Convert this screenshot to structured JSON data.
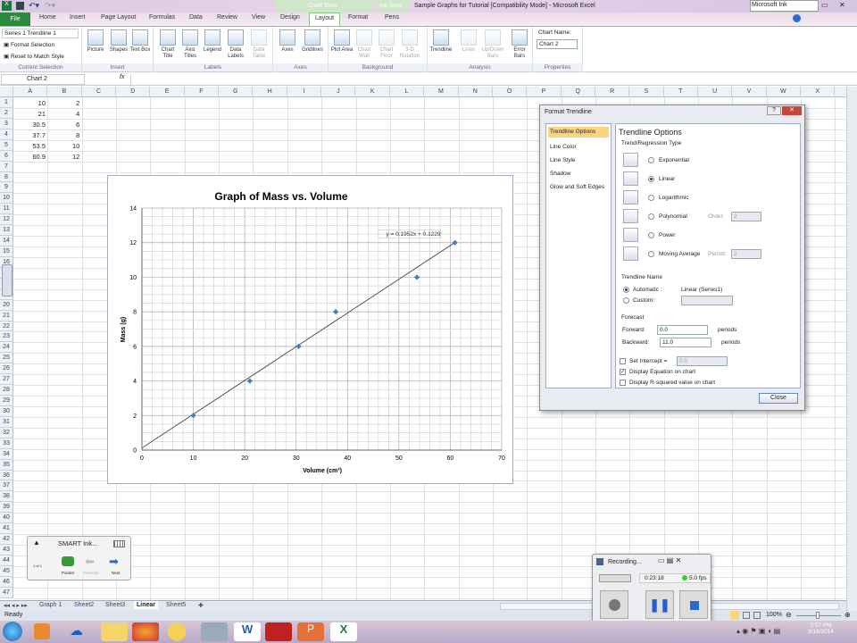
{
  "window": {
    "title": "Sample Graphs for Tutorial  [Compatibility Mode]  -  Microsoft Excel",
    "chart_tools": "Chart Tools",
    "ink_tools": "Ink Tools",
    "ink_toolbar": "Microsoft Ink"
  },
  "tabs": [
    "File",
    "Home",
    "Insert",
    "Page Layout",
    "Formulas",
    "Data",
    "Review",
    "View",
    "Design",
    "Layout",
    "Format",
    "Pens"
  ],
  "ribbon": {
    "selection_dropdown": "Series 1 Trendline 1",
    "format_selection": "Format Selection",
    "reset_style": "Reset to Match Style",
    "groups": [
      "Current Selection",
      "Insert",
      "Labels",
      "Axes",
      "Background",
      "Analysis",
      "Properties"
    ],
    "buttons": [
      "Picture",
      "Shapes",
      "Text Box",
      "Chart Title",
      "Axis Titles",
      "Legend",
      "Data Labels",
      "Data Table",
      "Axes",
      "Gridlines",
      "Plot Area",
      "Chart Wall",
      "Chart Floor",
      "3-D Rotation",
      "Trendline",
      "Lines",
      "Up/Down Bars",
      "Error Bars"
    ],
    "chart_name_label": "Chart Name:",
    "chart_name": "Chart 2"
  },
  "formula_bar": {
    "name_box": "Chart 2",
    "fx": "fx",
    "value": ""
  },
  "columns": [
    "A",
    "B",
    "C",
    "D",
    "E",
    "F",
    "G",
    "H",
    "I",
    "J",
    "K",
    "L",
    "M",
    "N",
    "O",
    "P",
    "Q",
    "R",
    "S",
    "T",
    "U",
    "V",
    "W",
    "X"
  ],
  "cells": {
    "A": [
      "10",
      "21",
      "30.5",
      "37.7",
      "53.5",
      "60.9"
    ],
    "B": [
      "2",
      "4",
      "6",
      "8",
      "10",
      "12"
    ]
  },
  "chart_data": {
    "type": "scatter",
    "title": "Graph of Mass vs. Volume",
    "xlabel": "Volume (cm³)",
    "ylabel": "Mass (g)",
    "xlim": [
      0,
      70
    ],
    "ylim": [
      0,
      14
    ],
    "xticks": [
      "0",
      "10",
      "20",
      "30",
      "40",
      "50",
      "60",
      "70"
    ],
    "yticks": [
      "0",
      "2",
      "4",
      "6",
      "8",
      "10",
      "12",
      "14"
    ],
    "grid": "on",
    "legend": "none",
    "x": [
      10,
      21,
      30.5,
      37.7,
      53.5,
      60.9
    ],
    "y": [
      2,
      4,
      6,
      8,
      10,
      12
    ],
    "trendline": {
      "type": "linear",
      "slope": 0.1952,
      "intercept": 0.1229,
      "equation": "y = 0.1952x + 0.1229"
    },
    "point_color": "#4a7ebb"
  },
  "dialog": {
    "title": "Format Trendline",
    "nav": [
      "Trendline Options",
      "Line Color",
      "Line Style",
      "Shadow",
      "Glow and Soft Edges"
    ],
    "heading": "Trendline Options",
    "type_group": "Trend/Regression Type",
    "types": [
      "Exponential",
      "Linear",
      "Logarithmic",
      "Polynomial",
      "Power",
      "Moving Average"
    ],
    "selected_type": "Linear",
    "order_label": "Order:",
    "order": "2",
    "period_label": "Period:",
    "period": "2",
    "name_group": "Trendline Name",
    "automatic": "Automatic :",
    "automatic_value": "Linear (Series1)",
    "custom": "Custom:",
    "forecast_group": "Forecast",
    "forward_label": "Forward:",
    "forward": "0.0",
    "backward_label": "Backward:",
    "backward": "11.0",
    "periods": "periods",
    "set_intercept": "Set Intercept =",
    "intercept": "0.0",
    "display_equation": "Display Equation on chart",
    "display_r2": "Display R-squared value on chart",
    "close": "Close"
  },
  "sheets": [
    "Graph 1",
    "Sheet2",
    "Sheet3",
    "Linear",
    "Sheet5"
  ],
  "active_sheet": "Linear",
  "status": {
    "ready": "Ready",
    "zoom": "100%"
  },
  "smart_ink": {
    "title": "SMART Ink...",
    "page": "1 of 1",
    "pointer": "Pointer",
    "previous": "Previous",
    "next": "Next"
  },
  "recorder": {
    "title": "Recording...",
    "time": "0:23:18",
    "fps": "5.0 fps"
  },
  "clock": {
    "time": "2:57 PM",
    "date": "9/16/2014"
  }
}
